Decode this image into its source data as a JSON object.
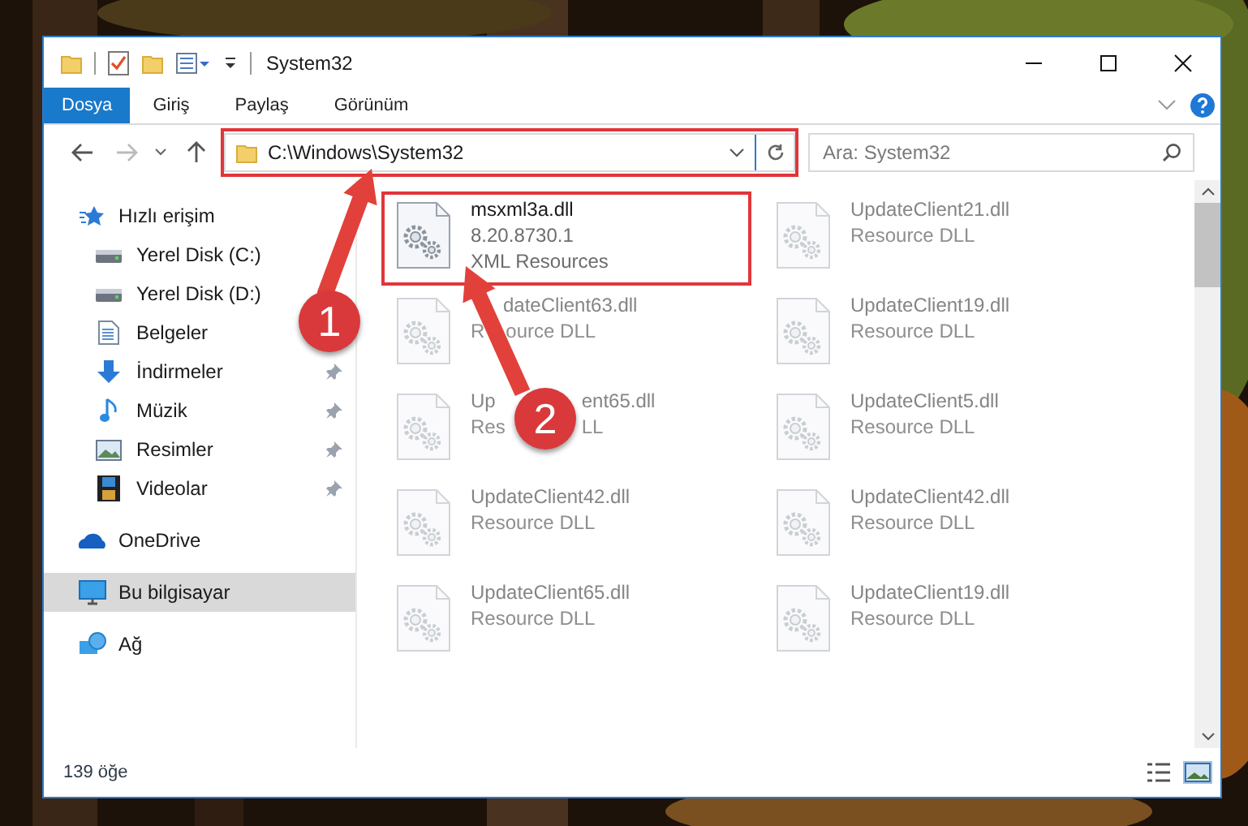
{
  "window": {
    "title": "System32"
  },
  "ribbon": {
    "tabs": [
      {
        "label": "Dosya",
        "kind": "file"
      },
      {
        "label": "Giriş",
        "kind": "tab"
      },
      {
        "label": "Paylaş",
        "kind": "tab"
      },
      {
        "label": "Görünüm",
        "kind": "tab"
      }
    ]
  },
  "address": {
    "value": "C:\\Windows\\System32",
    "highlighted": true
  },
  "search": {
    "placeholder": "Ara: System32"
  },
  "sidebar": {
    "items": [
      {
        "label": "Hızlı erişim",
        "kind": "star",
        "selected": false,
        "children": [
          {
            "label": "Yerel Disk (C:)",
            "kind": "drive",
            "pinned": false
          },
          {
            "label": "Yerel Disk (D:)",
            "kind": "drive",
            "pinned": false
          },
          {
            "label": "Belgeler",
            "kind": "document",
            "pinned": false
          },
          {
            "label": "İndirmeler",
            "kind": "download",
            "pinned": true
          },
          {
            "label": "Müzik",
            "kind": "music",
            "pinned": true
          },
          {
            "label": "Resimler",
            "kind": "pictures",
            "pinned": true
          },
          {
            "label": "Videolar",
            "kind": "video",
            "pinned": true
          }
        ]
      },
      {
        "label": "OneDrive",
        "kind": "cloud",
        "selected": false
      },
      {
        "label": "Bu bilgisayar",
        "kind": "computer",
        "selected": true
      },
      {
        "label": "Ağ",
        "kind": "network",
        "selected": false
      }
    ]
  },
  "files": [
    {
      "name": [
        "msxml3a.dll"
      ],
      "lines": [
        [
          "8.20.8730.1"
        ],
        [
          "XML Resources"
        ]
      ],
      "blurred": false,
      "highlighted": true
    },
    {
      "name": [
        "UpdateClient21.dll"
      ],
      "lines": [
        [
          "Resource DLL"
        ]
      ],
      "blurred": true,
      "highlighted": false
    },
    {
      "name": [
        "dateClient63.dll"
      ],
      "lines": [
        [
          "R",
          "ource DLL"
        ]
      ],
      "blurred": true,
      "highlighted": false
    },
    {
      "name": [
        "UpdateClient19.dll"
      ],
      "lines": [
        [
          "Resource DLL"
        ]
      ],
      "blurred": true,
      "highlighted": false
    },
    {
      "name": [
        "Up",
        "ent65.dll"
      ],
      "lines": [
        [
          "Res",
          "LL"
        ]
      ],
      "blurred": true,
      "highlighted": false
    },
    {
      "name": [
        "UpdateClient5.dll"
      ],
      "lines": [
        [
          "Resource DLL"
        ]
      ],
      "blurred": true,
      "highlighted": false
    },
    {
      "name": [
        "UpdateClient42.dll"
      ],
      "lines": [
        [
          "Resource DLL"
        ]
      ],
      "blurred": true,
      "highlighted": false
    },
    {
      "name": [
        "UpdateClient42.dll"
      ],
      "lines": [
        [
          "Resource DLL"
        ]
      ],
      "blurred": true,
      "highlighted": false
    },
    {
      "name": [
        "UpdateClient65.dll"
      ],
      "lines": [
        [
          "Resource DLL"
        ]
      ],
      "blurred": true,
      "highlighted": false
    },
    {
      "name": [
        "UpdateClient19.dll"
      ],
      "lines": [
        [
          "Resource DLL"
        ]
      ],
      "blurred": true,
      "highlighted": false
    }
  ],
  "status_bar": {
    "count": "139 öğe"
  },
  "callouts": [
    {
      "number": "1"
    },
    {
      "number": "2"
    }
  ]
}
